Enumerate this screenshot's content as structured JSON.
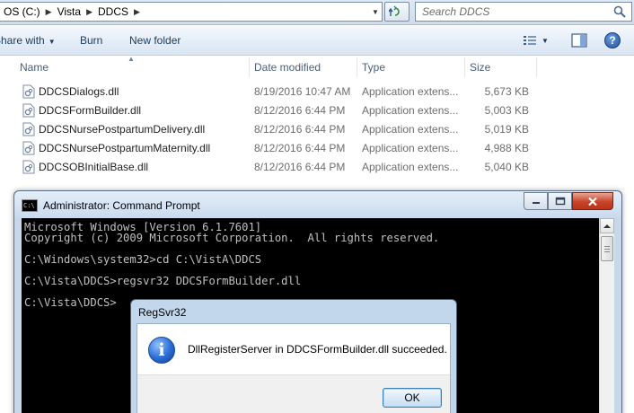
{
  "explorer": {
    "breadcrumb": [
      "OS (C:)",
      "Vista",
      "DDCS"
    ],
    "search": {
      "placeholder": "Search DDCS"
    },
    "toolbar": {
      "share_label": "Share with",
      "burn_label": "Burn",
      "new_folder_label": "New folder"
    },
    "columns": {
      "name": "Name",
      "date_modified": "Date modified",
      "type": "Type",
      "size": "Size"
    },
    "files": [
      {
        "name": "DDCSDialogs.dll",
        "date": "8/19/2016 10:47 AM",
        "type": "Application extens...",
        "size": "5,673 KB"
      },
      {
        "name": "DDCSFormBuilder.dll",
        "date": "8/12/2016 6:44 PM",
        "type": "Application extens...",
        "size": "5,003 KB"
      },
      {
        "name": "DDCSNursePostpartumDelivery.dll",
        "date": "8/12/2016 6:44 PM",
        "type": "Application extens...",
        "size": "5,019 KB"
      },
      {
        "name": "DDCSNursePostpartumMaternity.dll",
        "date": "8/12/2016 6:44 PM",
        "type": "Application extens...",
        "size": "4,988 KB"
      },
      {
        "name": "DDCSOBInitialBase.dll",
        "date": "8/12/2016 6:44 PM",
        "type": "Application extens...",
        "size": "5,040 KB"
      }
    ]
  },
  "cmd": {
    "title": "Administrator: Command Prompt",
    "icon_label": "C:\\",
    "lines": [
      "Microsoft Windows [Version 6.1.7601]",
      "Copyright (c) 2009 Microsoft Corporation.  All rights reserved.",
      "",
      "C:\\Windows\\system32>cd C:\\VistA\\DDCS",
      "",
      "C:\\Vista\\DDCS>regsvr32 DDCSFormBuilder.dll",
      "",
      "C:\\Vista\\DDCS>"
    ]
  },
  "dialog": {
    "title": "RegSvr32",
    "message": "DllRegisterServer in DDCSFormBuilder.dll succeeded.",
    "ok_label": "OK"
  },
  "icons": {
    "search": "search-icon",
    "refresh": "refresh-icon",
    "help": "help-icon",
    "info": "info-icon",
    "dll": "dll-file-icon"
  },
  "colors": {
    "toolbar_text": "#1e395b",
    "console_bg": "#000000",
    "console_text": "#c0c0c0",
    "close_button": "#c8432a",
    "info_blue": "#2a6cd4"
  }
}
